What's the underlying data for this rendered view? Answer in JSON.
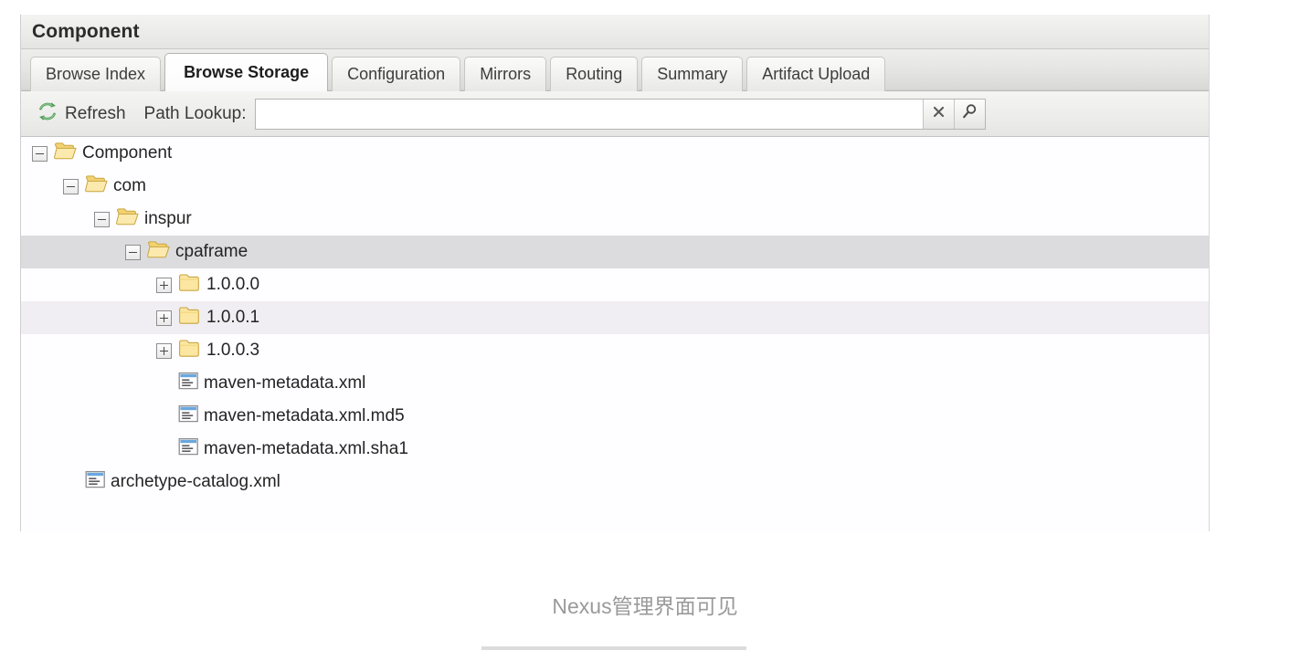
{
  "panel": {
    "title": "Component"
  },
  "tabs": [
    {
      "label": "Browse Index",
      "active": false
    },
    {
      "label": "Browse Storage",
      "active": true
    },
    {
      "label": "Configuration",
      "active": false
    },
    {
      "label": "Mirrors",
      "active": false
    },
    {
      "label": "Routing",
      "active": false
    },
    {
      "label": "Summary",
      "active": false
    },
    {
      "label": "Artifact Upload",
      "active": false
    }
  ],
  "toolbar": {
    "refresh_label": "Refresh",
    "refresh_icon": "refresh-icon",
    "path_lookup_label": "Path Lookup:",
    "lookup_value": "",
    "lookup_placeholder": "",
    "clear_icon": "close-icon",
    "search_icon": "search-icon"
  },
  "tree": [
    {
      "label": "Component",
      "indent": 0,
      "expander": "minus",
      "icon": "folder-open-icon",
      "state": "plain"
    },
    {
      "label": "com",
      "indent": 1,
      "expander": "minus",
      "icon": "folder-open-icon",
      "state": "plain"
    },
    {
      "label": "inspur",
      "indent": 2,
      "expander": "minus",
      "icon": "folder-open-icon",
      "state": "plain"
    },
    {
      "label": "cpaframe",
      "indent": 3,
      "expander": "minus",
      "icon": "folder-open-icon",
      "state": "selected"
    },
    {
      "label": "1.0.0.0",
      "indent": 4,
      "expander": "plus",
      "icon": "folder-closed-icon",
      "state": "plain"
    },
    {
      "label": "1.0.0.1",
      "indent": 4,
      "expander": "plus",
      "icon": "folder-closed-icon",
      "state": "stripe"
    },
    {
      "label": "1.0.0.3",
      "indent": 4,
      "expander": "plus",
      "icon": "folder-closed-icon",
      "state": "plain"
    },
    {
      "label": "maven-metadata.xml",
      "indent": 4,
      "expander": "none",
      "icon": "xml-file-icon",
      "state": "plain"
    },
    {
      "label": "maven-metadata.xml.md5",
      "indent": 4,
      "expander": "none",
      "icon": "xml-file-icon",
      "state": "plain"
    },
    {
      "label": "maven-metadata.xml.sha1",
      "indent": 4,
      "expander": "none",
      "icon": "xml-file-icon",
      "state": "plain"
    },
    {
      "label": "archetype-catalog.xml",
      "indent": 1,
      "expander": "none",
      "icon": "xml-file-icon",
      "state": "plain"
    }
  ],
  "caption": {
    "text": "Nexus管理界面可见"
  },
  "colors": {
    "selected_row": "#dcdcde",
    "stripe_row": "#f0eef2",
    "folder_yellow": "#f5d97a",
    "refresh_green": "#55a45b",
    "caption_gray": "#9a9a9a"
  }
}
